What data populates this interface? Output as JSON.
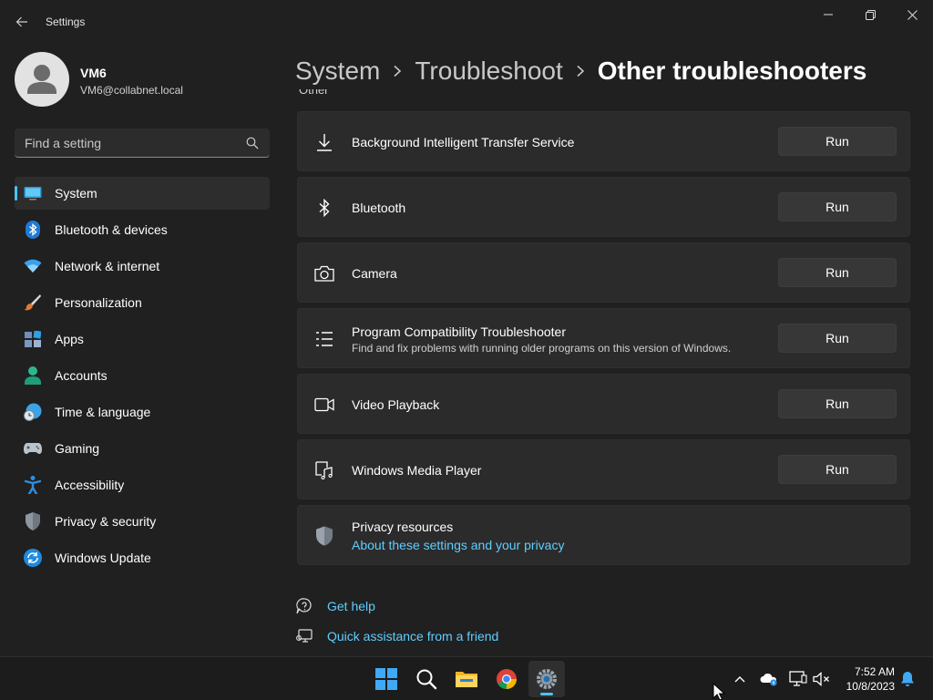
{
  "window": {
    "title": "Settings",
    "minimize_glyph": "—",
    "maximize_glyph": "❐",
    "close_glyph": "✕"
  },
  "profile": {
    "name": "VM6",
    "email": "VM6@collabnet.local"
  },
  "search": {
    "placeholder": "Find a setting"
  },
  "sidebar": {
    "items": [
      {
        "label": "System",
        "icon": "system-icon",
        "selected": true
      },
      {
        "label": "Bluetooth & devices",
        "icon": "bluetooth-devices-icon"
      },
      {
        "label": "Network & internet",
        "icon": "wifi-icon"
      },
      {
        "label": "Personalization",
        "icon": "brush-icon"
      },
      {
        "label": "Apps",
        "icon": "apps-icon"
      },
      {
        "label": "Accounts",
        "icon": "accounts-icon"
      },
      {
        "label": "Time & language",
        "icon": "time-language-icon"
      },
      {
        "label": "Gaming",
        "icon": "gamepad-icon"
      },
      {
        "label": "Accessibility",
        "icon": "accessibility-icon"
      },
      {
        "label": "Privacy & security",
        "icon": "shield-icon"
      },
      {
        "label": "Windows Update",
        "icon": "windows-update-icon"
      }
    ]
  },
  "breadcrumb": {
    "items": [
      "System",
      "Troubleshoot",
      "Other troubleshooters"
    ]
  },
  "section_label": "Other",
  "troubleshooters": [
    {
      "title": "Background Intelligent Transfer Service",
      "icon": "download-icon",
      "button": "Run"
    },
    {
      "title": "Bluetooth",
      "icon": "bluetooth-icon",
      "button": "Run"
    },
    {
      "title": "Camera",
      "icon": "camera-icon",
      "button": "Run"
    },
    {
      "title": "Program Compatibility Troubleshooter",
      "description": "Find and fix problems with running older programs on this version of Windows.",
      "icon": "list-icon",
      "button": "Run"
    },
    {
      "title": "Video Playback",
      "icon": "video-icon",
      "button": "Run"
    },
    {
      "title": "Windows Media Player",
      "icon": "media-player-icon",
      "button": "Run"
    }
  ],
  "privacy": {
    "title": "Privacy resources",
    "link": "About these settings and your privacy",
    "icon": "shield-icon"
  },
  "help": {
    "get_help": "Get help",
    "quick_assist": "Quick assistance from a friend"
  },
  "taskbar": {
    "apps": [
      "start-icon",
      "search-icon",
      "file-explorer-icon",
      "chrome-icon",
      "settings-icon"
    ],
    "clock_time": "7:52 AM",
    "clock_date": "10/8/2023"
  },
  "colors": {
    "accent": "#4cc2ff",
    "link": "#60cdff",
    "background": "#202020",
    "card": "#2b2b2b"
  }
}
